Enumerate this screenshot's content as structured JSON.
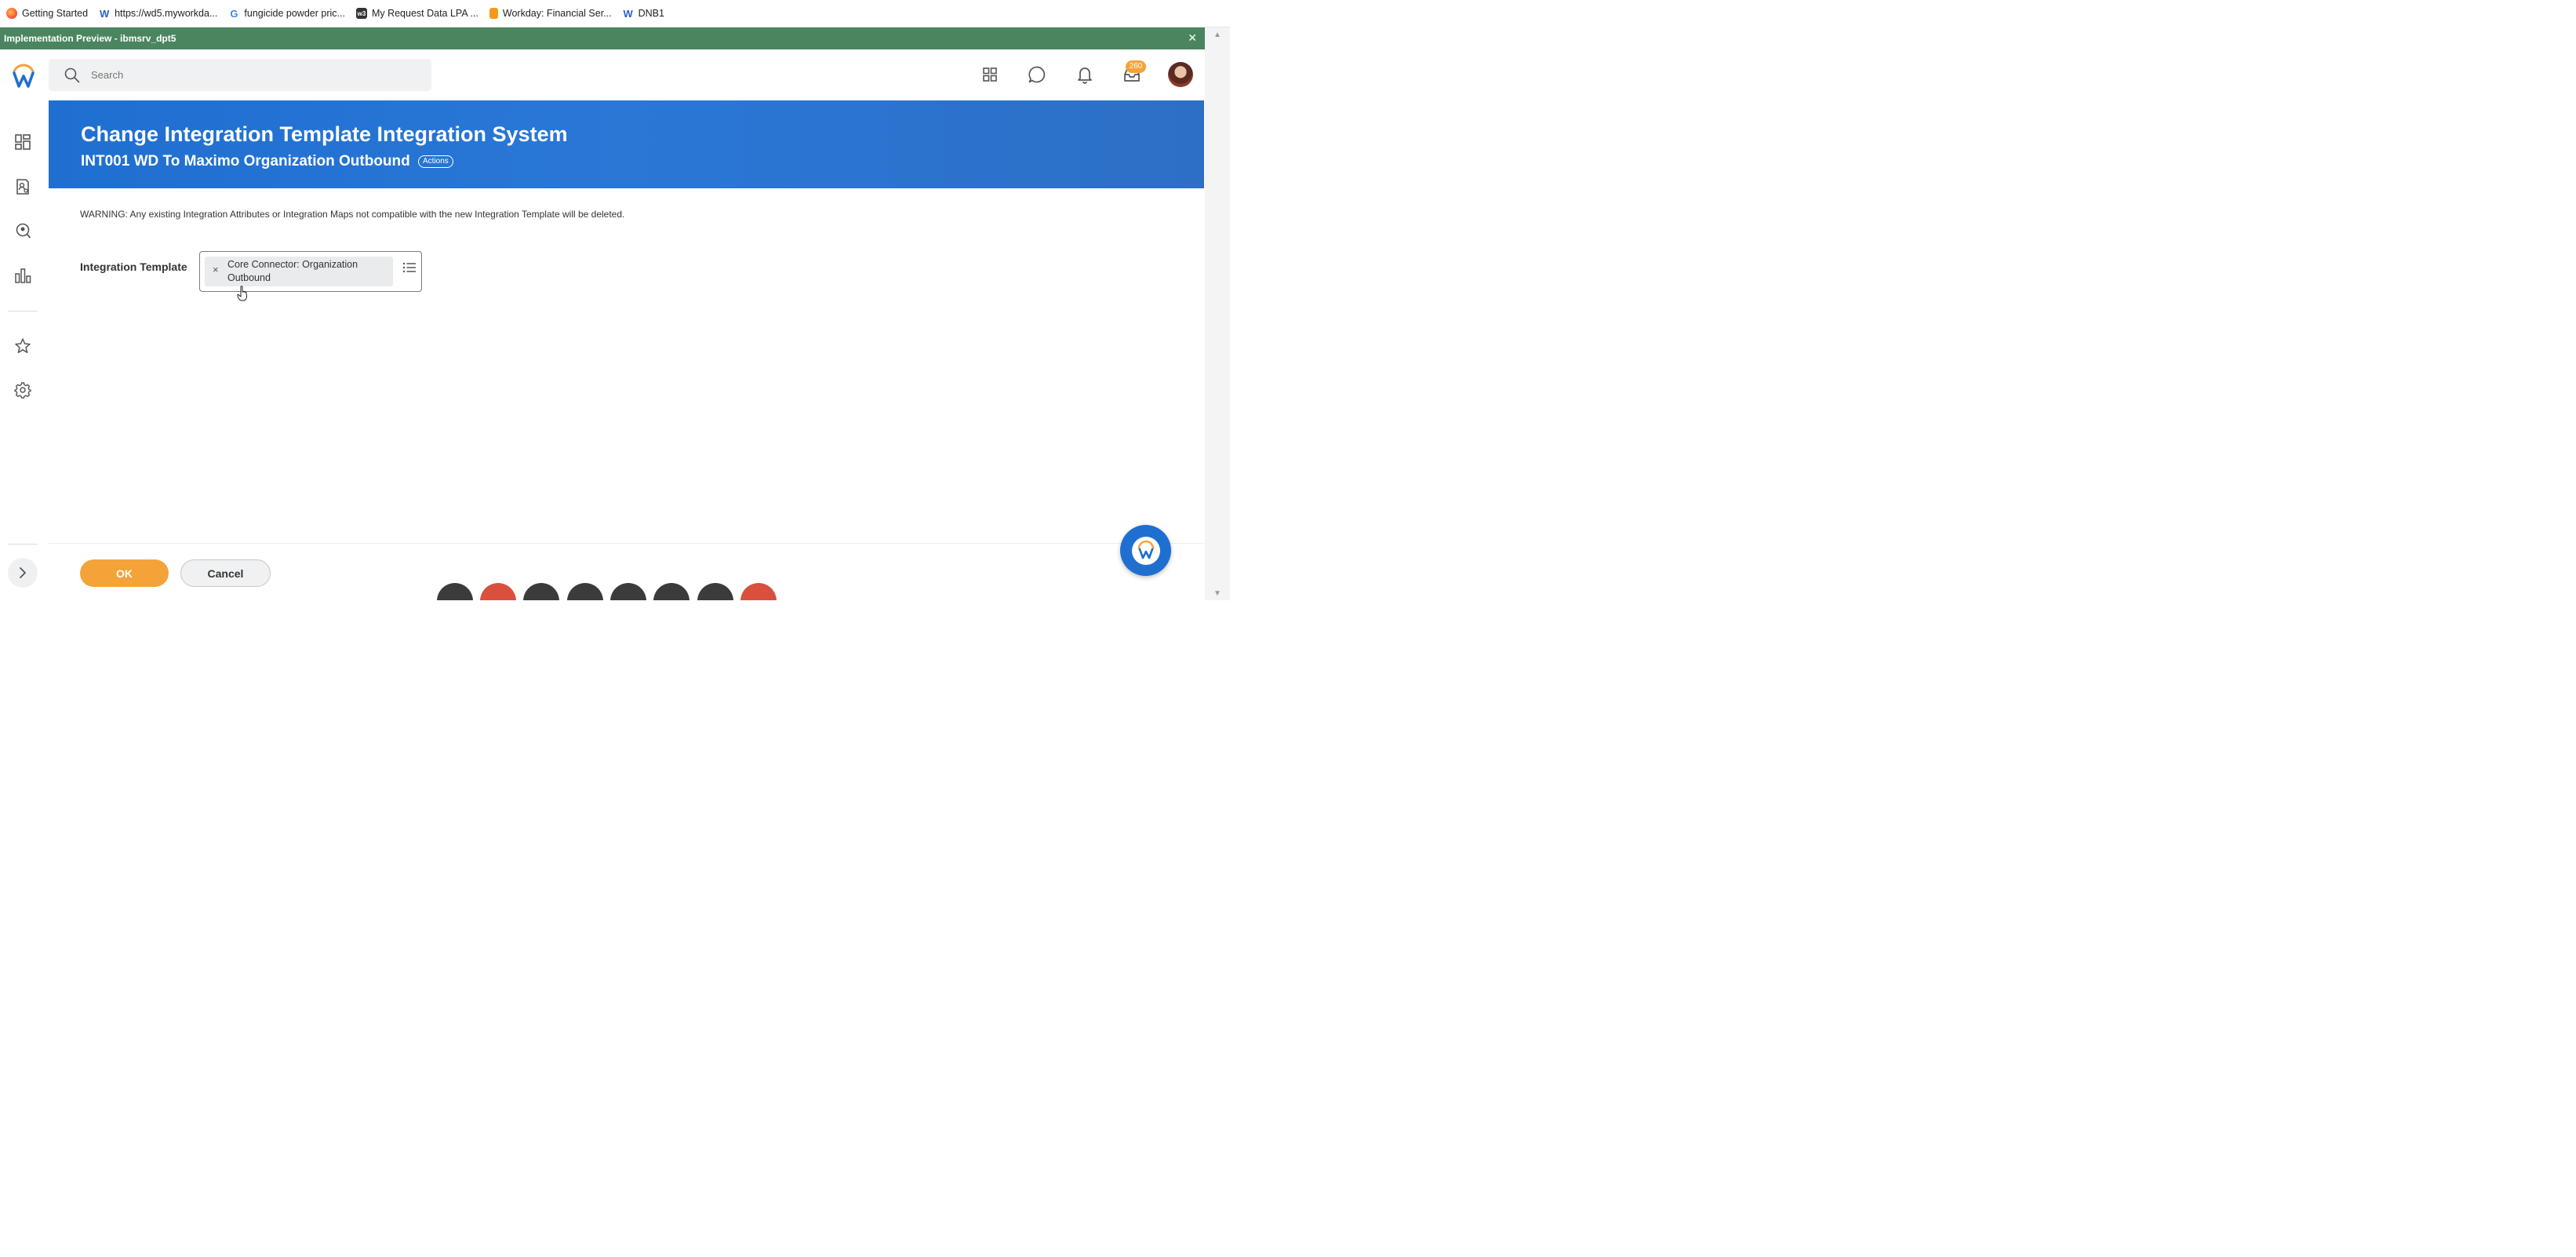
{
  "browser": {
    "bookmarks": [
      {
        "label": "Getting Started",
        "icon": "firefox-icon"
      },
      {
        "label": "https://wd5.myworkda...",
        "icon": "workday-icon"
      },
      {
        "label": "fungicide powder pric...",
        "icon": "google-icon"
      },
      {
        "label": "My Request Data LPA ...",
        "icon": "w3-icon"
      },
      {
        "label": "Workday: Financial Ser...",
        "icon": "bag-icon"
      },
      {
        "label": "DNB1",
        "icon": "workday-icon"
      }
    ]
  },
  "preview_bar": {
    "title": "Implementation Preview - ibmsrv_dpt5",
    "close_symbol": "✕"
  },
  "header": {
    "search_placeholder": "Search",
    "inbox_count": "260",
    "icons": [
      "apps-grid-icon",
      "chat-bubble-icon",
      "notifications-bell-icon",
      "inbox-icon"
    ]
  },
  "leftnav": {
    "items": [
      "dashboard-icon",
      "person-search-icon",
      "search-detail-icon",
      "reports-chart-icon",
      "favorites-star-icon",
      "settings-gear-icon"
    ],
    "expand_symbol": "›"
  },
  "banner": {
    "title": "Change Integration Template Integration System",
    "subtitle": "INT001 WD To Maximo Organization Outbound",
    "actions_label": "Actions"
  },
  "form": {
    "warning": "WARNING: Any existing Integration Attributes or Integration Maps not compatible with the new Integration Template will be deleted.",
    "field_label": "Integration Template",
    "selected_value": "Core Connector: Organization Outbound",
    "remove_symbol": "×"
  },
  "footer": {
    "ok_label": "OK",
    "cancel_label": "Cancel"
  },
  "colors": {
    "brand_blue": "#1f6fd1",
    "accent_orange": "#f4a339",
    "preview_green": "#4a8560"
  }
}
